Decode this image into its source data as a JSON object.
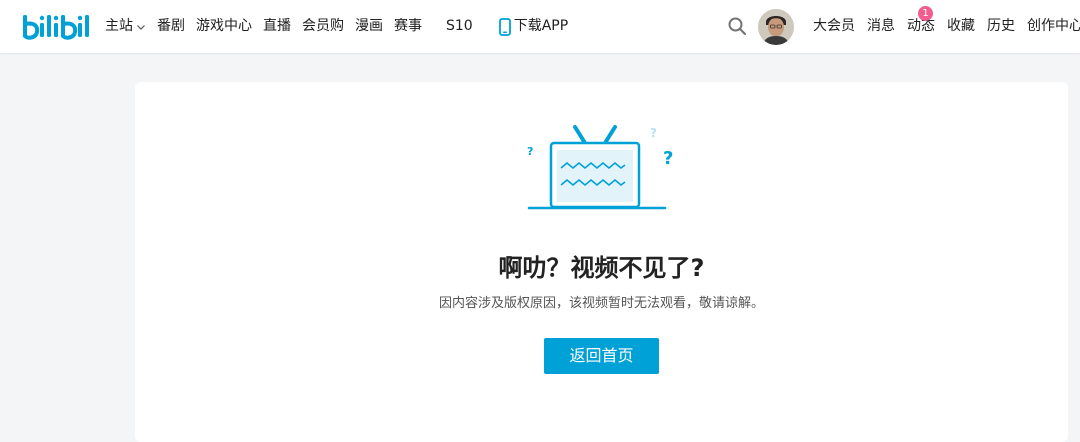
{
  "header": {
    "logo_text": "bilibili",
    "nav": [
      {
        "label": "主站",
        "has_dropdown": true
      },
      {
        "label": "番剧"
      },
      {
        "label": "游戏中心"
      },
      {
        "label": "直播"
      },
      {
        "label": "会员购"
      },
      {
        "label": "漫画"
      },
      {
        "label": "赛事"
      }
    ],
    "s10_label": "S10",
    "download_label": "下载APP",
    "user_menu": [
      {
        "label": "大会员"
      },
      {
        "label": "消息"
      },
      {
        "label": "动态",
        "badge": "1"
      },
      {
        "label": "收藏"
      },
      {
        "label": "历史"
      },
      {
        "label": "创作中心"
      }
    ]
  },
  "main": {
    "title": "啊叻？视频不见了?",
    "description": "因内容涉及版权原因，该视频暂时无法观看，敬请谅解。",
    "home_button_label": "返回首页"
  },
  "colors": {
    "brand": "#00a1d6",
    "badge": "#f25d8e",
    "background": "#f4f5f7"
  },
  "icons": [
    "bilibili-logo",
    "chevron-down-icon",
    "phone-icon",
    "search-icon",
    "avatar",
    "broken-tv-illustration"
  ]
}
